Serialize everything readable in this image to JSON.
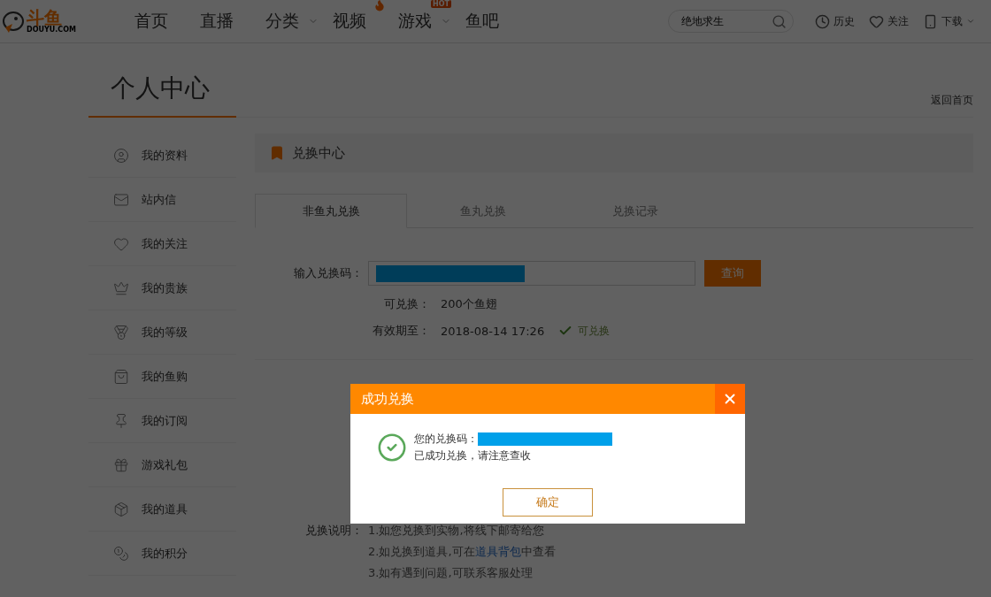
{
  "header": {
    "logo": {
      "name": "斗鱼",
      "domain": "DOUYU.COM"
    },
    "nav": [
      {
        "label": "首页",
        "kind": "plain",
        "dropdown": false
      },
      {
        "label": "直播",
        "kind": "plain",
        "dropdown": false
      },
      {
        "label": "分类",
        "kind": "plain",
        "dropdown": true
      },
      {
        "label": "视频",
        "kind": "fire",
        "dropdown": false
      },
      {
        "label": "游戏",
        "kind": "hot",
        "badge": "HOT",
        "dropdown": true
      },
      {
        "label": "鱼吧",
        "kind": "plain",
        "dropdown": false
      }
    ],
    "search": {
      "placeholder": "绝地求生"
    },
    "actions": [
      {
        "label": "历史",
        "kind": "history"
      },
      {
        "label": "关注",
        "kind": "follow"
      },
      {
        "label": "下载",
        "kind": "download"
      }
    ]
  },
  "page_title": "个人中心",
  "back_link": "返回首页",
  "sidebar": {
    "items": [
      {
        "label": "我的资料"
      },
      {
        "label": "站内信"
      },
      {
        "label": "我的关注"
      },
      {
        "label": "我的贵族"
      },
      {
        "label": "我的等级"
      },
      {
        "label": "我的鱼购"
      },
      {
        "label": "我的订阅"
      },
      {
        "label": "游戏礼包"
      },
      {
        "label": "我的道具"
      },
      {
        "label": "我的积分"
      }
    ]
  },
  "section_title": "兑换中心",
  "tabs": [
    {
      "label": "非鱼丸兑换",
      "selected": true
    },
    {
      "label": "鱼丸兑换",
      "selected": false
    },
    {
      "label": "兑换记录",
      "selected": false
    }
  ],
  "form": {
    "code_label": "输入兑换码：",
    "query_button": "查询",
    "details": [
      {
        "label": "可兑换：",
        "value": "200个鱼翅"
      },
      {
        "label": "有效期至：",
        "value": "2018-08-14 17:26",
        "status": "可兑换"
      }
    ]
  },
  "instructions": {
    "label": "兑换说明：",
    "lines": [
      {
        "text": "1.如您兑换到实物,将线下邮寄给您"
      },
      {
        "text": "2.如兑换到道具,可在",
        "link": "道具背包",
        "after": "中查看"
      },
      {
        "text": "3.如有遇到问题,可联系客服处理"
      }
    ]
  },
  "dialog": {
    "title": "成功兑换",
    "code_label": "您的兑换码：",
    "message": "已成功兑换，请注意查收",
    "confirm": "确定"
  }
}
